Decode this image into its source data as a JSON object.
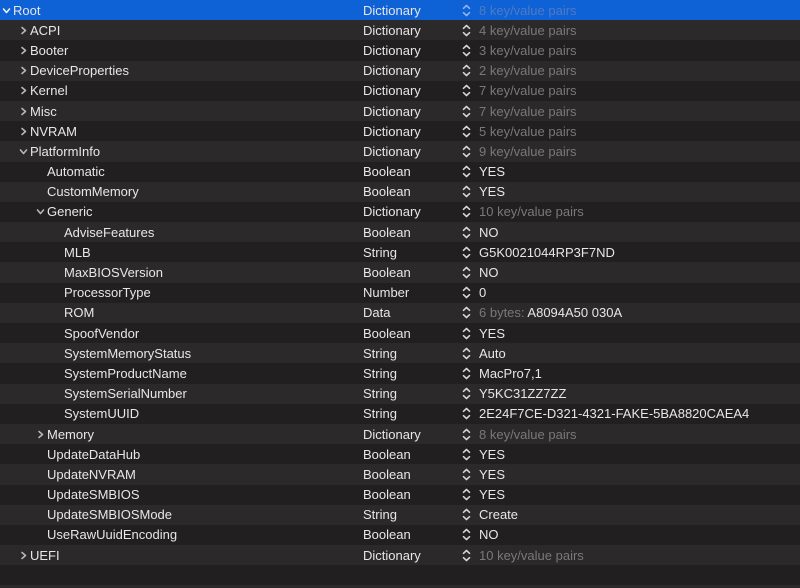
{
  "app": {
    "description": "plist editor outliner (dark theme)",
    "columns": [
      "key",
      "type",
      "value"
    ]
  },
  "colors": {
    "selection_blue": "#0f61d6",
    "row_dark": "#211f1f",
    "row_light": "#2b2929",
    "text_primary": "#e8e6e6",
    "text_muted": "#7b7878",
    "text_muted_on_selection": "#4f7bc3",
    "stepper_icon": "#d6d4d4",
    "stepper_icon_on_selection": "#8fb5ef",
    "disclosure_icon": "#b9b6b6"
  },
  "icons": {
    "disclosure_collapsed": "chevron-right-icon",
    "disclosure_expanded": "chevron-down-icon",
    "type_stepper": "up-down-stepper-icon"
  },
  "outline": {
    "selected_key": "Root",
    "rows": [
      {
        "key": "Root",
        "type": "Dictionary",
        "level": 0,
        "disclosure": "expanded",
        "selected": true,
        "value": "8 key/value pairs",
        "value_muted": true
      },
      {
        "key": "ACPI",
        "type": "Dictionary",
        "level": 1,
        "disclosure": "collapsed",
        "selected": false,
        "value": "4 key/value pairs",
        "value_muted": true
      },
      {
        "key": "Booter",
        "type": "Dictionary",
        "level": 1,
        "disclosure": "collapsed",
        "selected": false,
        "value": "3 key/value pairs",
        "value_muted": true
      },
      {
        "key": "DeviceProperties",
        "type": "Dictionary",
        "level": 1,
        "disclosure": "collapsed",
        "selected": false,
        "value": "2 key/value pairs",
        "value_muted": true
      },
      {
        "key": "Kernel",
        "type": "Dictionary",
        "level": 1,
        "disclosure": "collapsed",
        "selected": false,
        "value": "7 key/value pairs",
        "value_muted": true
      },
      {
        "key": "Misc",
        "type": "Dictionary",
        "level": 1,
        "disclosure": "collapsed",
        "selected": false,
        "value": "7 key/value pairs",
        "value_muted": true
      },
      {
        "key": "NVRAM",
        "type": "Dictionary",
        "level": 1,
        "disclosure": "collapsed",
        "selected": false,
        "value": "5 key/value pairs",
        "value_muted": true
      },
      {
        "key": "PlatformInfo",
        "type": "Dictionary",
        "level": 1,
        "disclosure": "expanded",
        "selected": false,
        "value": "9 key/value pairs",
        "value_muted": true
      },
      {
        "key": "Automatic",
        "type": "Boolean",
        "level": 2,
        "disclosure": null,
        "selected": false,
        "value": "YES",
        "value_muted": false
      },
      {
        "key": "CustomMemory",
        "type": "Boolean",
        "level": 2,
        "disclosure": null,
        "selected": false,
        "value": "YES",
        "value_muted": false
      },
      {
        "key": "Generic",
        "type": "Dictionary",
        "level": 2,
        "disclosure": "expanded",
        "selected": false,
        "value": "10 key/value pairs",
        "value_muted": true
      },
      {
        "key": "AdviseFeatures",
        "type": "Boolean",
        "level": 3,
        "disclosure": null,
        "selected": false,
        "value": "NO",
        "value_muted": false
      },
      {
        "key": "MLB",
        "type": "String",
        "level": 3,
        "disclosure": null,
        "selected": false,
        "value": "G5K0021044RP3F7ND",
        "value_muted": false
      },
      {
        "key": "MaxBIOSVersion",
        "type": "Boolean",
        "level": 3,
        "disclosure": null,
        "selected": false,
        "value": "NO",
        "value_muted": false
      },
      {
        "key": "ProcessorType",
        "type": "Number",
        "level": 3,
        "disclosure": null,
        "selected": false,
        "value": "0",
        "value_muted": false
      },
      {
        "key": "ROM",
        "type": "Data",
        "level": 3,
        "disclosure": null,
        "selected": false,
        "value_prefix": "6 bytes: ",
        "value": "A8094A50 030A",
        "value_muted": false
      },
      {
        "key": "SpoofVendor",
        "type": "Boolean",
        "level": 3,
        "disclosure": null,
        "selected": false,
        "value": "YES",
        "value_muted": false
      },
      {
        "key": "SystemMemoryStatus",
        "type": "String",
        "level": 3,
        "disclosure": null,
        "selected": false,
        "value": "Auto",
        "value_muted": false
      },
      {
        "key": "SystemProductName",
        "type": "String",
        "level": 3,
        "disclosure": null,
        "selected": false,
        "value": "MacPro7,1",
        "value_muted": false
      },
      {
        "key": "SystemSerialNumber",
        "type": "String",
        "level": 3,
        "disclosure": null,
        "selected": false,
        "value": "Y5KC31ZZ7ZZ",
        "value_muted": false
      },
      {
        "key": "SystemUUID",
        "type": "String",
        "level": 3,
        "disclosure": null,
        "selected": false,
        "value": "2E24F7CE-D321-4321-FAKE-5BA8820CAEA4",
        "value_muted": false
      },
      {
        "key": "Memory",
        "type": "Dictionary",
        "level": 2,
        "disclosure": "collapsed",
        "selected": false,
        "value": "8 key/value pairs",
        "value_muted": true
      },
      {
        "key": "UpdateDataHub",
        "type": "Boolean",
        "level": 2,
        "disclosure": null,
        "selected": false,
        "value": "YES",
        "value_muted": false
      },
      {
        "key": "UpdateNVRAM",
        "type": "Boolean",
        "level": 2,
        "disclosure": null,
        "selected": false,
        "value": "YES",
        "value_muted": false
      },
      {
        "key": "UpdateSMBIOS",
        "type": "Boolean",
        "level": 2,
        "disclosure": null,
        "selected": false,
        "value": "YES",
        "value_muted": false
      },
      {
        "key": "UpdateSMBIOSMode",
        "type": "String",
        "level": 2,
        "disclosure": null,
        "selected": false,
        "value": "Create",
        "value_muted": false
      },
      {
        "key": "UseRawUuidEncoding",
        "type": "Boolean",
        "level": 2,
        "disclosure": null,
        "selected": false,
        "value": "NO",
        "value_muted": false
      },
      {
        "key": "UEFI",
        "type": "Dictionary",
        "level": 1,
        "disclosure": "collapsed",
        "selected": false,
        "value": "10 key/value pairs",
        "value_muted": true
      }
    ]
  }
}
